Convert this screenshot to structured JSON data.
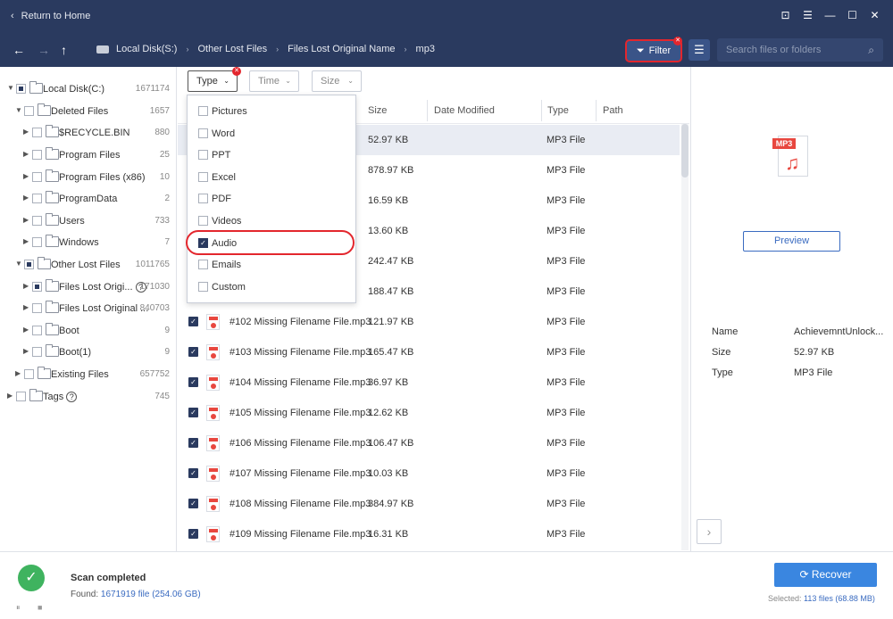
{
  "titlebar": {
    "return_label": "Return to Home",
    "controls": [
      "⊡",
      "☰",
      "—",
      "☐",
      "✕"
    ]
  },
  "nav": {
    "back_icon": "←",
    "forward_icon": "→",
    "up_icon": "↑",
    "breadcrumb": [
      "Local Disk(S:)",
      "Other Lost Files",
      "Files Lost Original Name",
      "mp3"
    ]
  },
  "toolbar": {
    "filter_label": "Filter",
    "list_icon": "☰",
    "search_placeholder": "Search files or folders"
  },
  "tree": [
    {
      "label": "Local Disk(C:)",
      "count": "1671174"
    },
    {
      "label": "Deleted Files",
      "count": "1657"
    },
    {
      "label": "$RECYCLE.BIN",
      "count": "880"
    },
    {
      "label": "Program Files",
      "count": "25"
    },
    {
      "label": "Program Files (x86)",
      "count": "10"
    },
    {
      "label": "ProgramData",
      "count": "2"
    },
    {
      "label": "Users",
      "count": "733"
    },
    {
      "label": "Windows",
      "count": "7"
    },
    {
      "label": "Other Lost Files",
      "count": "1011765"
    },
    {
      "label": "Files Lost Origi...",
      "count": "171030"
    },
    {
      "label": "Files Lost Original ...",
      "count": "840703"
    },
    {
      "label": "Boot",
      "count": "9"
    },
    {
      "label": "Boot(1)",
      "count": "9"
    },
    {
      "label": "Existing Files",
      "count": "657752"
    },
    {
      "label": "Tags",
      "count": "745"
    }
  ],
  "filters": {
    "type": "Type",
    "time": "Time",
    "size": "Size"
  },
  "columns": {
    "size": "Size",
    "date": "Date Modified",
    "type": "Type",
    "path": "Path"
  },
  "dropdown": [
    "Pictures",
    "Word",
    "PPT",
    "Excel",
    "PDF",
    "Videos",
    "Audio",
    "Emails",
    "Custom"
  ],
  "files": [
    {
      "name": "",
      "size": "52.97 KB",
      "type": "MP3 File"
    },
    {
      "name": "",
      "size": "878.97 KB",
      "type": "MP3 File"
    },
    {
      "name": "",
      "size": "16.59 KB",
      "type": "MP3 File"
    },
    {
      "name": "",
      "size": "13.60 KB",
      "type": "MP3 File"
    },
    {
      "name": "",
      "size": "242.47 KB",
      "type": "MP3 File"
    },
    {
      "name": "",
      "size": "188.47 KB",
      "type": "MP3 File"
    },
    {
      "name": "#102 Missing Filename File.mp3",
      "size": "121.97 KB",
      "type": "MP3 File"
    },
    {
      "name": "#103 Missing Filename File.mp3",
      "size": "165.47 KB",
      "type": "MP3 File"
    },
    {
      "name": "#104 Missing Filename File.mp3",
      "size": "36.97 KB",
      "type": "MP3 File"
    },
    {
      "name": "#105 Missing Filename File.mp3",
      "size": "12.62 KB",
      "type": "MP3 File"
    },
    {
      "name": "#106 Missing Filename File.mp3",
      "size": "106.47 KB",
      "type": "MP3 File"
    },
    {
      "name": "#107 Missing Filename File.mp3",
      "size": "10.03 KB",
      "type": "MP3 File"
    },
    {
      "name": "#108 Missing Filename File.mp3",
      "size": "384.97 KB",
      "type": "MP3 File"
    },
    {
      "name": "#109 Missing Filename File.mp3",
      "size": "16.31 KB",
      "type": "MP3 File"
    }
  ],
  "preview": {
    "icon_tag": "MP3",
    "button": "Preview",
    "name_label": "Name",
    "name_value": "AchievemntUnlock...",
    "size_label": "Size",
    "size_value": "52.97 KB",
    "type_label": "Type",
    "type_value": "MP3 File"
  },
  "status": {
    "title": "Scan completed",
    "found_prefix": "Found: ",
    "found_value": "1671919 file (254.06 GB)",
    "recover_label": "Recover",
    "selected_prefix": "Selected: ",
    "selected_value": "113 files (68.88 MB)"
  },
  "colors": {
    "accent": "#2a3a5f",
    "highlight": "#e3262d",
    "recover": "#3a86e0"
  }
}
